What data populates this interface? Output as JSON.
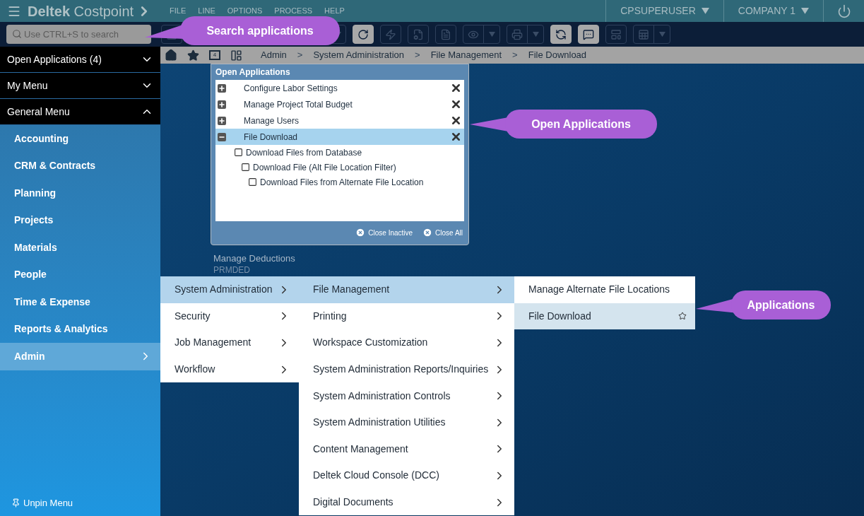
{
  "header": {
    "brand": "Deltek",
    "product": "Costpoint",
    "menu": [
      "FILE",
      "LINE",
      "OPTIONS",
      "PROCESS",
      "HELP"
    ],
    "user": "CPSUPERUSER",
    "company": "COMPANY 1"
  },
  "search": {
    "placeholder": "Use CTRL+S to search"
  },
  "toolbar": [
    {
      "kind": "blank",
      "enabled": false,
      "dropdown": false
    },
    {
      "kind": "blank",
      "enabled": false,
      "dropdown": true
    },
    {
      "kind": "refresh",
      "enabled": true,
      "dropdown": false
    },
    {
      "kind": "bolt",
      "enabled": false,
      "dropdown": false
    },
    {
      "kind": "wrench",
      "enabled": false,
      "dropdown": false
    },
    {
      "kind": "doc",
      "enabled": false,
      "dropdown": false
    },
    {
      "kind": "eye",
      "enabled": false,
      "dropdown": true
    },
    {
      "kind": "print",
      "enabled": false,
      "dropdown": true
    },
    {
      "kind": "sync",
      "enabled": true,
      "dropdown": false
    },
    {
      "kind": "comment",
      "enabled": true,
      "dropdown": false
    },
    {
      "kind": "layout",
      "enabled": false,
      "dropdown": false
    },
    {
      "kind": "excel",
      "enabled": false,
      "dropdown": true
    }
  ],
  "sidebar": {
    "sections": [
      {
        "label": "Open Applications (4)",
        "expanded": false
      },
      {
        "label": "My Menu",
        "expanded": false
      },
      {
        "label": "General Menu",
        "expanded": true
      }
    ],
    "items": [
      {
        "label": "Accounting",
        "selected": false
      },
      {
        "label": "CRM & Contracts",
        "selected": false
      },
      {
        "label": "Planning",
        "selected": false
      },
      {
        "label": "Projects",
        "selected": false
      },
      {
        "label": "Materials",
        "selected": false
      },
      {
        "label": "People",
        "selected": false
      },
      {
        "label": "Time & Expense",
        "selected": false
      },
      {
        "label": "Reports & Analytics",
        "selected": false
      },
      {
        "label": "Admin",
        "selected": true
      }
    ],
    "unpin": "Unpin Menu"
  },
  "breadcrumb": {
    "calendar_day": "4",
    "path": [
      {
        "kind": "link",
        "text": "Admin"
      },
      {
        "kind": "separator",
        "text": ">"
      },
      {
        "kind": "link",
        "text": "System Administration"
      },
      {
        "kind": "separator",
        "text": ">"
      },
      {
        "kind": "link",
        "text": "File Management"
      },
      {
        "kind": "separator",
        "text": ">"
      },
      {
        "kind": "link",
        "text": "File Download"
      }
    ]
  },
  "open_applications": {
    "title": "Open Applications",
    "items": [
      {
        "label": "Configure Labor Settings",
        "expanded": false,
        "selected": false
      },
      {
        "label": "Manage Project Total Budget",
        "expanded": false,
        "selected": false
      },
      {
        "label": "Manage Users",
        "expanded": false,
        "selected": false
      },
      {
        "label": "File Download",
        "expanded": true,
        "selected": true,
        "children": [
          {
            "label": "Download Files from Database",
            "children": [
              {
                "label": "Download File (Alt File Location Filter)",
                "children": [
                  {
                    "label": "Download Files from Alternate File Location"
                  }
                ]
              }
            ]
          }
        ]
      }
    ],
    "actions": [
      "Close Inactive",
      "Close All"
    ]
  },
  "background_tile": {
    "name": "Manage Deductions",
    "code": "PRMDED"
  },
  "menus": [
    [
      {
        "label": "System Administration",
        "selected": true,
        "submenu": true
      },
      {
        "label": "Security",
        "selected": false,
        "submenu": true
      },
      {
        "label": "Job Management",
        "selected": false,
        "submenu": true
      },
      {
        "label": "Workflow",
        "selected": false,
        "submenu": true
      }
    ],
    [
      {
        "label": "File Management",
        "selected": true,
        "submenu": true
      },
      {
        "label": "Printing",
        "selected": false,
        "submenu": true
      },
      {
        "label": "Workspace Customization",
        "selected": false,
        "submenu": true
      },
      {
        "label": "System Administration Reports/Inquiries",
        "selected": false,
        "submenu": true
      },
      {
        "label": "System Administration Controls",
        "selected": false,
        "submenu": true
      },
      {
        "label": "System Administration Utilities",
        "selected": false,
        "submenu": true
      },
      {
        "label": "Content Management",
        "selected": false,
        "submenu": true
      },
      {
        "label": "Deltek Cloud Console (DCC)",
        "selected": false,
        "submenu": true
      },
      {
        "label": "Digital Documents",
        "selected": false,
        "submenu": true
      }
    ],
    [
      {
        "label": "Manage Alternate File Locations",
        "selected": false,
        "submenu": false,
        "star": false
      },
      {
        "label": "File Download",
        "selected": true,
        "submenu": false,
        "star": true
      }
    ]
  ],
  "callouts": [
    "Search applications",
    "Open Applications",
    "Applications"
  ]
}
